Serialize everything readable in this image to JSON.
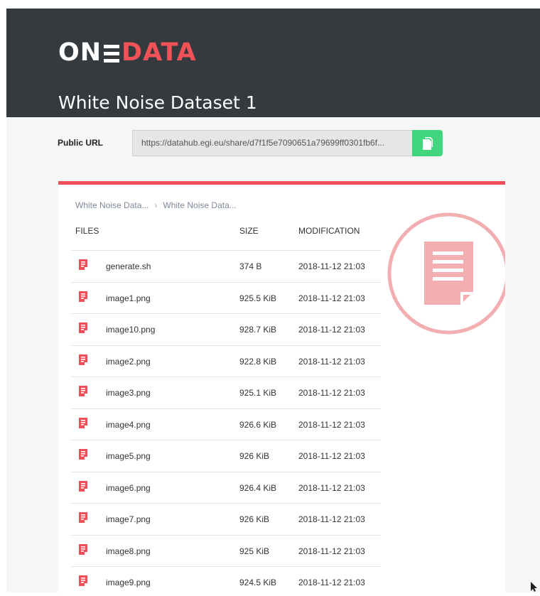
{
  "brand": {
    "logo_left": "ON",
    "logo_right": "DATA",
    "logo_color_accent": "#f05258"
  },
  "header": {
    "title": "White Noise Dataset 1",
    "background": "#353a3e"
  },
  "public_url": {
    "label": "Public URL",
    "value": "https://datahub.egi.eu/share/d7f1f5e7090651a79699ff0301fb6f...",
    "copy_icon": "copy-icon",
    "copy_color": "#3fd67e"
  },
  "browser": {
    "breadcrumb": [
      "White Noise Data...",
      "White Noise Data..."
    ],
    "columns": {
      "files": "FILES",
      "size": "SIZE",
      "modification": "MODIFICATION"
    },
    "accent": "#f04e58",
    "files": [
      {
        "name": "generate.sh",
        "size": "374 B",
        "modified": "2018-11-12 21:03"
      },
      {
        "name": "image1.png",
        "size": "925.5 KiB",
        "modified": "2018-11-12 21:03"
      },
      {
        "name": "image10.png",
        "size": "928.7 KiB",
        "modified": "2018-11-12 21:03"
      },
      {
        "name": "image2.png",
        "size": "922.8 KiB",
        "modified": "2018-11-12 21:03"
      },
      {
        "name": "image3.png",
        "size": "925.1 KiB",
        "modified": "2018-11-12 21:03"
      },
      {
        "name": "image4.png",
        "size": "926.6 KiB",
        "modified": "2018-11-12 21:03"
      },
      {
        "name": "image5.png",
        "size": "926 KiB",
        "modified": "2018-11-12 21:03"
      },
      {
        "name": "image6.png",
        "size": "926.4 KiB",
        "modified": "2018-11-12 21:03"
      },
      {
        "name": "image7.png",
        "size": "926 KiB",
        "modified": "2018-11-12 21:03"
      },
      {
        "name": "image8.png",
        "size": "925 KiB",
        "modified": "2018-11-12 21:03"
      },
      {
        "name": "image9.png",
        "size": "924.5 KiB",
        "modified": "2018-11-12 21:03"
      }
    ],
    "file_icon": "file-icon",
    "preview_icon": "file-preview-icon"
  }
}
